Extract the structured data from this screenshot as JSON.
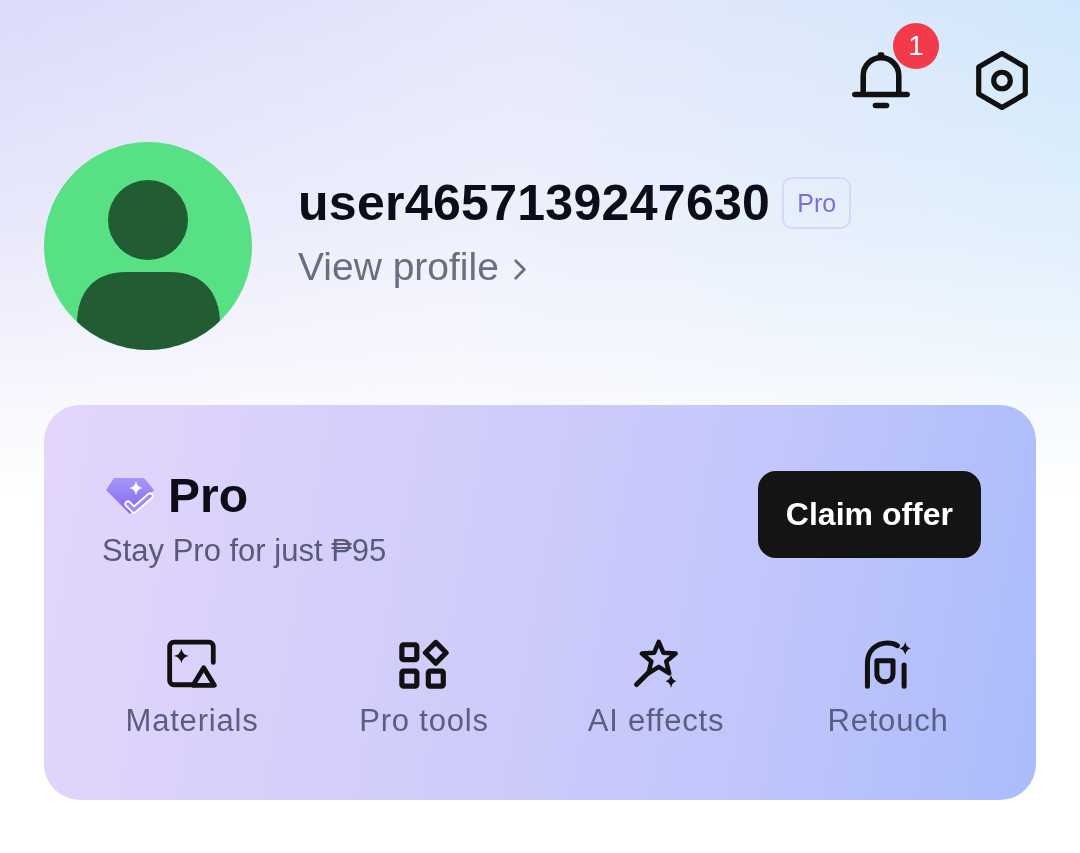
{
  "header": {
    "notification_count": "1"
  },
  "profile": {
    "username": "user4657139247630",
    "badge": "Pro",
    "link": "View profile"
  },
  "pro_card": {
    "title": "Pro",
    "subtitle": "Stay Pro for just ₱95",
    "button": "Claim offer",
    "features": [
      {
        "kind": "materials",
        "label": "Materials"
      },
      {
        "kind": "tools",
        "label": "Pro tools"
      },
      {
        "kind": "effects",
        "label": "AI effects"
      },
      {
        "kind": "retouch",
        "label": "Retouch"
      }
    ]
  }
}
